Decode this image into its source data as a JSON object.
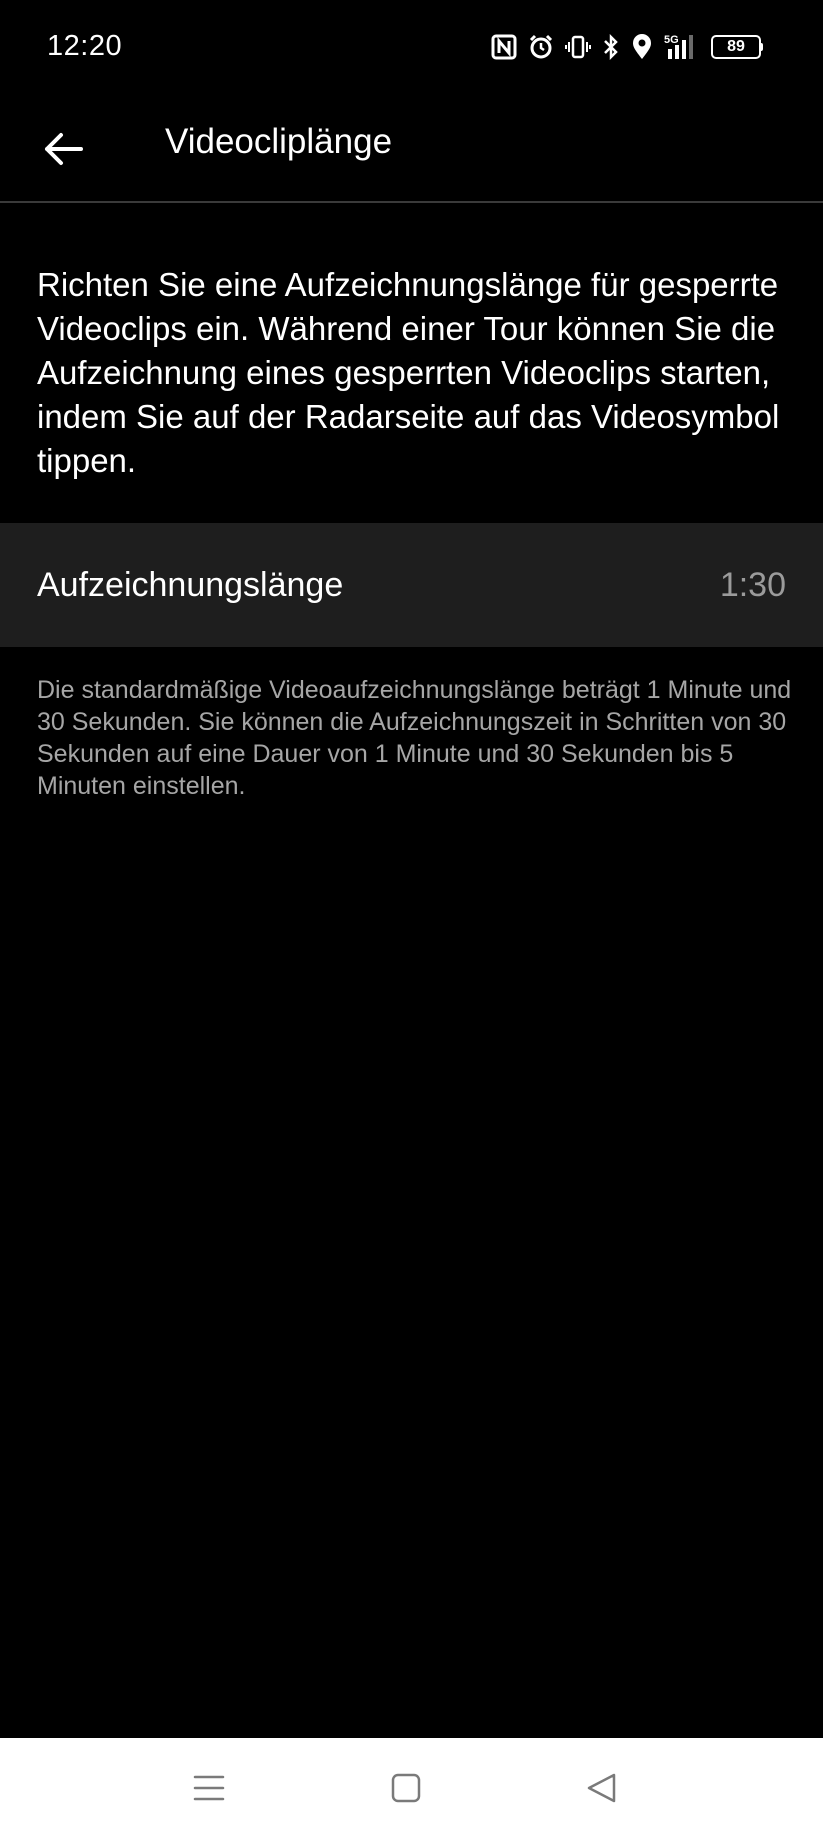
{
  "status_bar": {
    "time": "12:20",
    "network": "5G",
    "battery_level": "89",
    "icons": [
      "nfc-icon",
      "alarm-icon",
      "vibrate-icon",
      "bluetooth-icon",
      "location-icon",
      "signal-icon",
      "battery-icon"
    ]
  },
  "app_bar": {
    "title": "Videocliplänge",
    "back_icon": "arrow-left-icon"
  },
  "intro_text": "Richten Sie eine Aufzeichnungslänge für gesperrte Videoclips ein. Während einer Tour können Sie die Aufzeichnung eines gesperrten Videoclips starten, indem Sie auf der Radarseite auf das Videosymbol tippen.",
  "setting": {
    "label": "Aufzeichnungslänge",
    "value": "1:30"
  },
  "hint_text": "Die standardmäßige Videoaufzeichnungslänge beträgt 1 Minute und 30 Sekunden. Sie können die Aufzeichnungszeit in Schritten von 30 Sekunden auf eine Dauer von 1 Minute und 30 Sekunden bis 5 Minuten einstellen.",
  "nav_bar": {
    "buttons": [
      "menu-icon",
      "home-icon",
      "back-triangle-icon"
    ]
  },
  "colors": {
    "background": "#000000",
    "row_background": "#1e1e1e",
    "secondary_text": "#a6a6a6",
    "nav_background": "#ffffff"
  }
}
